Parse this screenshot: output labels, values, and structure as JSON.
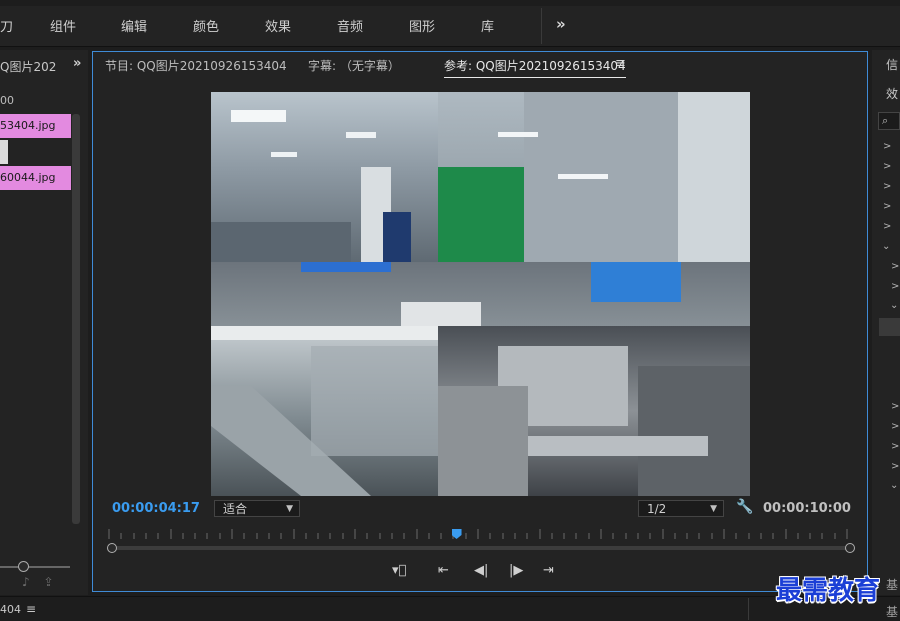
{
  "menu": {
    "items": [
      "刀",
      "组件",
      "编辑",
      "颜色",
      "效果",
      "音频",
      "图形",
      "库"
    ],
    "more_glyph": "»"
  },
  "project": {
    "tab_label": "Q图片202",
    "more_glyph": "»",
    "timecode": "00",
    "clips": [
      "53404.jpg",
      "60044.jpg"
    ]
  },
  "monitor": {
    "tab_source": "节目: QQ图片20210926153404",
    "tab_caption": "字幕: （无字幕）",
    "tab_reference": "参考: QQ图片20210926153404",
    "tab_menu_glyph": "≡",
    "current_time": "00:00:04:17",
    "fit_value": "适合",
    "resolution_value": "1/2",
    "duration": "00:00:10:00",
    "playhead_fraction": 0.471
  },
  "effects": {
    "tab1": "信",
    "tab2": "效",
    "bottom1": "基",
    "bottom2": "基"
  },
  "bottom": {
    "tab_label": "404",
    "menu_glyph": "≡"
  },
  "watermark": "最需教育",
  "colors": {
    "accent_blue": "#3a9cf0",
    "clip_pink": "#e38ae0",
    "panel_border": "#3f8bd6",
    "watermark_blue": "#1b3fd6"
  }
}
